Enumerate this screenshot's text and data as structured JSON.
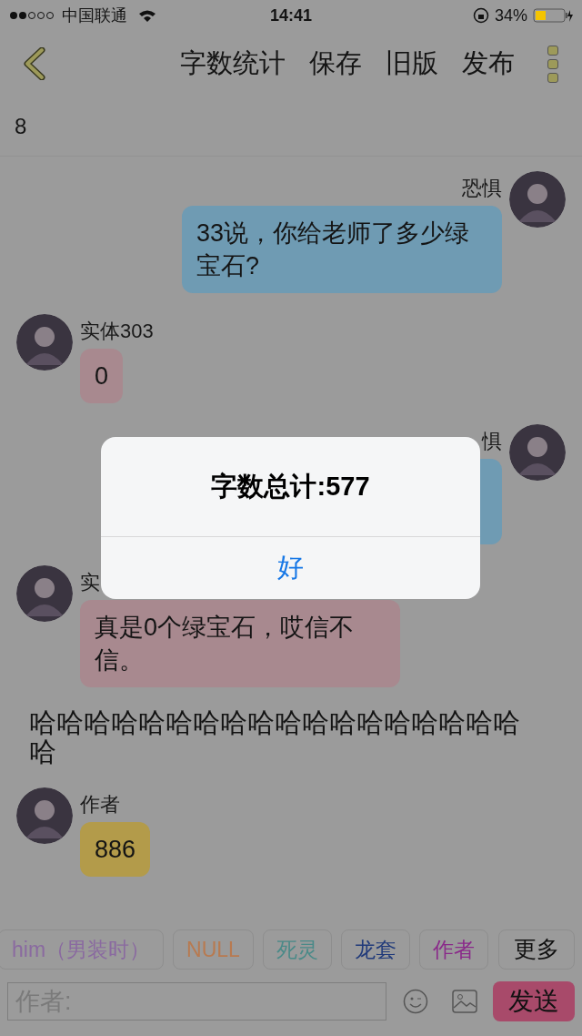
{
  "status_bar": {
    "carrier": "中国联通",
    "time": "14:41",
    "battery": "34%"
  },
  "nav": {
    "actions": [
      "字数统计",
      "保存",
      "旧版",
      "发布"
    ]
  },
  "count": "8",
  "messages": [
    {
      "kind": "message",
      "outgoing": true,
      "name": "恐惧",
      "text": "33说，你给老师了多少绿宝石?",
      "color": "#6f9bb3"
    },
    {
      "kind": "message",
      "outgoing": false,
      "name": "实体303",
      "text": "0",
      "color": "#a8898f"
    },
    {
      "kind": "message",
      "outgoing": true,
      "name": "惧",
      "color": "#6f9bb3"
    },
    {
      "kind": "message",
      "outgoing": false,
      "name": "实",
      "text": "真是0个绿宝石，哎信不信。",
      "color": "#a8898f"
    },
    {
      "kind": "narration",
      "text": "哈哈哈哈哈哈哈哈哈哈哈哈哈哈哈哈哈哈哈"
    },
    {
      "kind": "message",
      "outgoing": false,
      "name": "作者",
      "text": "886",
      "color": "#b39b4a"
    }
  ],
  "roles": [
    {
      "label": "him（男装时）",
      "color": "#8a6aa0"
    },
    {
      "label": "NULL",
      "color": "#b87a50"
    },
    {
      "label": "死灵",
      "color": "#4a8a88"
    },
    {
      "label": "龙套",
      "color": "#203a7a"
    },
    {
      "label": "作者",
      "color": "#8a2a8a"
    }
  ],
  "more_button": "更多",
  "input": {
    "placeholder": "作者:"
  },
  "send_button": "发送",
  "alert": {
    "title": "字数总计:577",
    "button": "好"
  }
}
